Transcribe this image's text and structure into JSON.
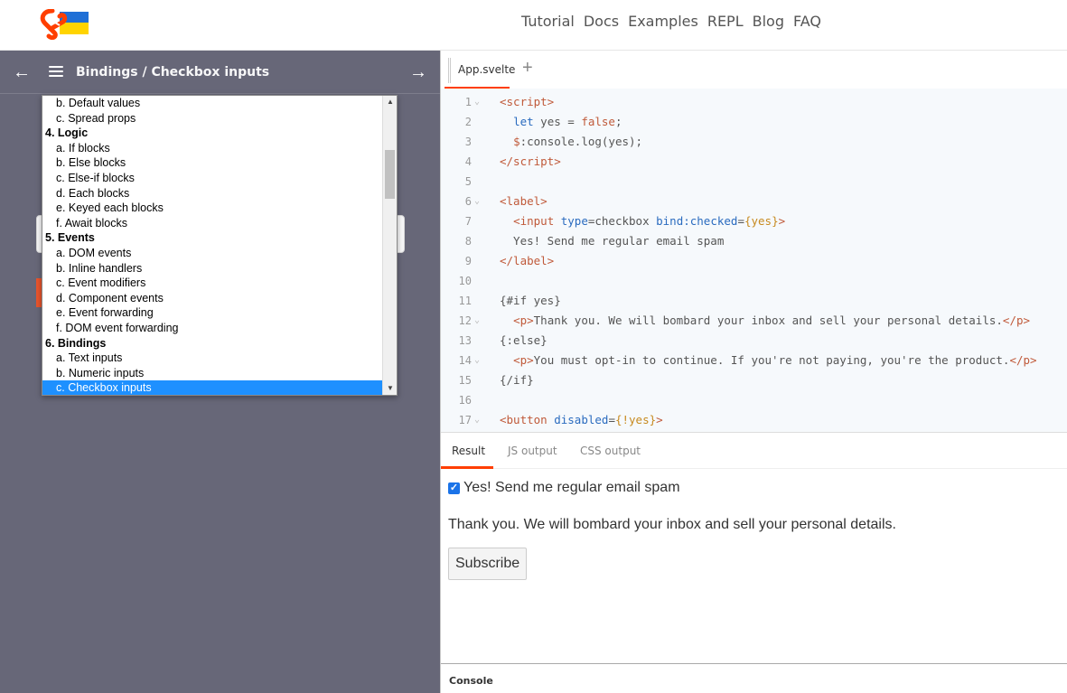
{
  "nav": {
    "links": [
      "Tutorial",
      "Docs",
      "Examples",
      "REPL",
      "Blog",
      "FAQ"
    ]
  },
  "chapter": {
    "title": "Bindings / Checkbox inputs"
  },
  "dropdown": {
    "items": [
      {
        "text": "b. Default values",
        "kind": "sub"
      },
      {
        "text": "c. Spread props",
        "kind": "sub"
      },
      {
        "text": "4. Logic",
        "kind": "group"
      },
      {
        "text": "a. If blocks",
        "kind": "sub"
      },
      {
        "text": "b. Else blocks",
        "kind": "sub"
      },
      {
        "text": "c. Else-if blocks",
        "kind": "sub"
      },
      {
        "text": "d. Each blocks",
        "kind": "sub"
      },
      {
        "text": "e. Keyed each blocks",
        "kind": "sub"
      },
      {
        "text": "f. Await blocks",
        "kind": "sub"
      },
      {
        "text": "5. Events",
        "kind": "group"
      },
      {
        "text": "a. DOM events",
        "kind": "sub"
      },
      {
        "text": "b. Inline handlers",
        "kind": "sub"
      },
      {
        "text": "c. Event modifiers",
        "kind": "sub"
      },
      {
        "text": "d. Component events",
        "kind": "sub"
      },
      {
        "text": "e. Event forwarding",
        "kind": "sub"
      },
      {
        "text": "f. DOM event forwarding",
        "kind": "sub"
      },
      {
        "text": "6. Bindings",
        "kind": "group"
      },
      {
        "text": "a. Text inputs",
        "kind": "sub"
      },
      {
        "text": "b. Numeric inputs",
        "kind": "sub"
      },
      {
        "text": "c. Checkbox inputs",
        "kind": "selected"
      }
    ]
  },
  "editor": {
    "file_tab": "App.svelte",
    "add_tab": "+",
    "lines": [
      {
        "n": "1",
        "fold": true,
        "html": "<span class='k-tag'>&lt;script&gt;</span>"
      },
      {
        "n": "2",
        "fold": false,
        "html": "  <span class='k-kw'>let</span> yes = <span class='k-bool'>false</span>;"
      },
      {
        "n": "3",
        "fold": false,
        "html": "  <span class='k-tag'>$</span>:console.log(yes);"
      },
      {
        "n": "4",
        "fold": false,
        "html": "<span class='k-tag'>&lt;/script&gt;</span>"
      },
      {
        "n": "5",
        "fold": false,
        "html": ""
      },
      {
        "n": "6",
        "fold": true,
        "html": "<span class='k-tag'>&lt;label&gt;</span>"
      },
      {
        "n": "7",
        "fold": false,
        "html": "  <span class='k-tag'>&lt;input</span> <span class='k-kw'>type</span>=checkbox <span class='k-kw'>bind:checked</span>=<span class='k-str'>{yes}</span><span class='k-tag'>&gt;</span>"
      },
      {
        "n": "8",
        "fold": false,
        "html": "  Yes! Send me regular email spam"
      },
      {
        "n": "9",
        "fold": false,
        "html": "<span class='k-tag'>&lt;/label&gt;</span>"
      },
      {
        "n": "10",
        "fold": false,
        "html": ""
      },
      {
        "n": "11",
        "fold": false,
        "html": "{#if yes}"
      },
      {
        "n": "12",
        "fold": true,
        "html": "  <span class='k-tag'>&lt;p&gt;</span>Thank you. We will bombard your inbox and sell your personal details.<span class='k-tag'>&lt;/p&gt;</span>"
      },
      {
        "n": "13",
        "fold": false,
        "html": "{:else}"
      },
      {
        "n": "14",
        "fold": true,
        "html": "  <span class='k-tag'>&lt;p&gt;</span>You must opt-in to continue. If you're not paying, you're the product.<span class='k-tag'>&lt;/p&gt;</span>"
      },
      {
        "n": "15",
        "fold": false,
        "html": "{/if}"
      },
      {
        "n": "16",
        "fold": false,
        "html": ""
      },
      {
        "n": "17",
        "fold": true,
        "html": "<span class='k-tag'>&lt;button</span> <span class='k-kw'>disabled</span>=<span class='k-str'>{!yes}</span><span class='k-tag'>&gt;</span>"
      }
    ]
  },
  "output_tabs": [
    "Result",
    "JS output",
    "CSS output"
  ],
  "result": {
    "checkbox_label": "Yes! Send me regular email spam",
    "checkbox_checked": true,
    "message": "Thank you. We will bombard your inbox and sell your personal details.",
    "button_label": "Subscribe"
  },
  "console": {
    "label": "Console"
  },
  "colors": {
    "accent": "#ff3e00",
    "left_bg": "#676778",
    "selected": "#1e90ff",
    "checkbox": "#1a73e8"
  }
}
